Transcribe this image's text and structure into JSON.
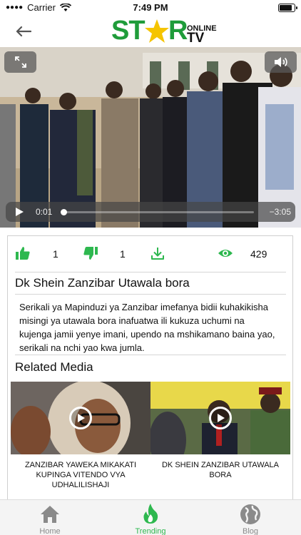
{
  "status_bar": {
    "carrier": "Carrier",
    "time": "7:49 PM"
  },
  "header": {
    "logo_star": "ST",
    "logo_r": "R",
    "logo_online": "ONLINE",
    "logo_tv": "TV",
    "back_icon": "back-arrow-icon"
  },
  "video": {
    "elapsed": "0:01",
    "remaining": "−3:05",
    "progress": 0.01,
    "fullscreen_icon": "expand-icon",
    "volume_icon": "speaker-icon"
  },
  "stats": {
    "likes": "1",
    "dislikes": "1",
    "views": "429"
  },
  "media": {
    "title": "Dk Shein Zanzibar Utawala bora",
    "description": "Serikali ya Mapinduzi ya Zanzibar imefanya bidii kuhakikisha misingi ya utawala bora inafuatwa ili kukuza uchumi na kujenga jamii yenye imani, upendo na mshikamano baina yao, serikali na nchi yao kwa jumla."
  },
  "related": {
    "heading": "Related Media",
    "items": [
      {
        "title": "ZANZIBAR YAWEKA MIKAKATI KUPINGA VITENDO VYA UDHALILISHAJI"
      },
      {
        "title": "DK SHEIN ZANZIBAR UTAWALA BORA"
      }
    ]
  },
  "tabs": [
    {
      "label": "Home",
      "icon": "home-icon"
    },
    {
      "label": "Trending",
      "icon": "flame-icon"
    },
    {
      "label": "Blog",
      "icon": "globe-icon"
    }
  ],
  "colors": {
    "accent": "#2eb84f",
    "logo_green": "#1f9c3a",
    "logo_star": "#f5c400",
    "inactive": "#8a8a8a"
  }
}
